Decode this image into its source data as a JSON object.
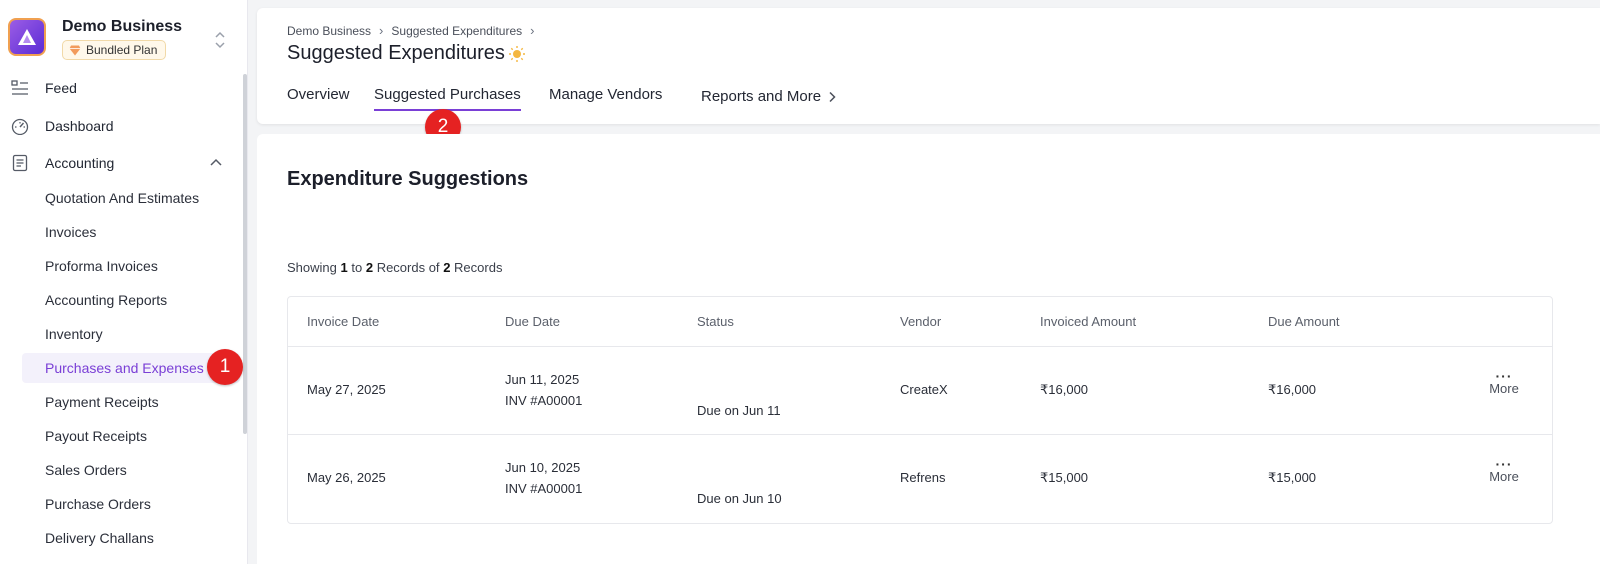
{
  "business": {
    "name": "Demo Business",
    "plan": "Bundled Plan"
  },
  "sidebar": {
    "nav": [
      {
        "label": "Feed",
        "icon": "feed-icon"
      },
      {
        "label": "Dashboard",
        "icon": "dashboard-icon"
      },
      {
        "label": "Accounting",
        "icon": "accounting-icon"
      }
    ],
    "sub_items": [
      {
        "label": "Quotation And Estimates"
      },
      {
        "label": "Invoices"
      },
      {
        "label": "Proforma Invoices"
      },
      {
        "label": "Accounting Reports"
      },
      {
        "label": "Inventory"
      },
      {
        "label": "Purchases and Expenses",
        "active": true
      },
      {
        "label": "Payment Receipts"
      },
      {
        "label": "Payout Receipts"
      },
      {
        "label": "Sales Orders"
      },
      {
        "label": "Purchase Orders"
      },
      {
        "label": "Delivery Challans"
      }
    ]
  },
  "callouts": {
    "first": "1",
    "second": "2"
  },
  "header": {
    "breadcrumb": [
      "Demo Business",
      "Suggested Expenditures"
    ],
    "title": "Suggested Expenditures",
    "tabs": [
      {
        "label": "Overview"
      },
      {
        "label": "Suggested Purchases",
        "active": true
      },
      {
        "label": "Manage Vendors"
      },
      {
        "label": "Reports and More"
      }
    ]
  },
  "main": {
    "section_title": "Expenditure Suggestions",
    "showing": {
      "prefix": "Showing",
      "from": "1",
      "to_word": "to",
      "to": "2",
      "records_word": "Records of",
      "total": "2",
      "suffix": "Records"
    },
    "table": {
      "columns": [
        "Invoice Date",
        "Due Date",
        "Status",
        "Vendor",
        "Invoiced Amount",
        "Due Amount"
      ],
      "rows": [
        {
          "invoice_date": "May 27, 2025",
          "due_date": "Jun 11, 2025",
          "invoice_no": "INV #A00001",
          "status": "Due on Jun 11",
          "vendor": "CreateX",
          "invoiced_amount": "₹16,000",
          "due_amount": "₹16,000",
          "more_label": "More"
        },
        {
          "invoice_date": "May 26, 2025",
          "due_date": "Jun 10, 2025",
          "invoice_no": "INV #A00001",
          "status": "Due on Jun 10",
          "vendor": "Refrens",
          "invoiced_amount": "₹15,000",
          "due_amount": "₹15,000",
          "more_label": "More"
        }
      ]
    }
  },
  "colors": {
    "accent": "#7a3fd6",
    "callout": "#e52222"
  }
}
